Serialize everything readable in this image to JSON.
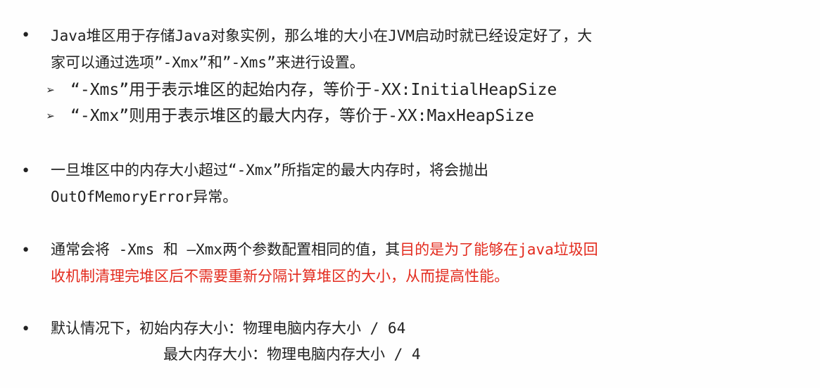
{
  "bullets": {
    "b1": {
      "dot": "•",
      "line1": "Java堆区用于存储Java对象实例，那么堆的大小在JVM启动时就已经设定好了，大",
      "line2": "家可以通过选项”-Xmx”和”-Xms”来进行设置。",
      "sub1_arrow": "➢",
      "sub1_text": "“-Xms”用于表示堆区的起始内存，等价于-XX:InitialHeapSize",
      "sub2_arrow": "➢",
      "sub2_text": "“-Xmx”则用于表示堆区的最大内存，等价于-XX:MaxHeapSize"
    },
    "b2": {
      "dot": "•",
      "line1": "一旦堆区中的内存大小超过“-Xmx”所指定的最大内存时，将会抛出",
      "line2": "OutOfMemoryError异常。"
    },
    "b3": {
      "dot": "•",
      "line1_normal": "通常会将 -Xms 和 —Xmx两个参数配置相同的值，其",
      "line1_red": "目的是为了能够在java垃圾回",
      "line2_red": "收机制清理完堆区后不需要重新分隔计算堆区的大小，从而提高性能。"
    },
    "b4": {
      "dot": "•",
      "line1": "默认情况下，初始内存大小：物理电脑内存大小 / 64",
      "line2": "最大内存大小：物理电脑内存大小 / 4"
    }
  },
  "colors": {
    "text": "#222222",
    "highlight": "#e32b1e",
    "background": "#ffffff"
  }
}
